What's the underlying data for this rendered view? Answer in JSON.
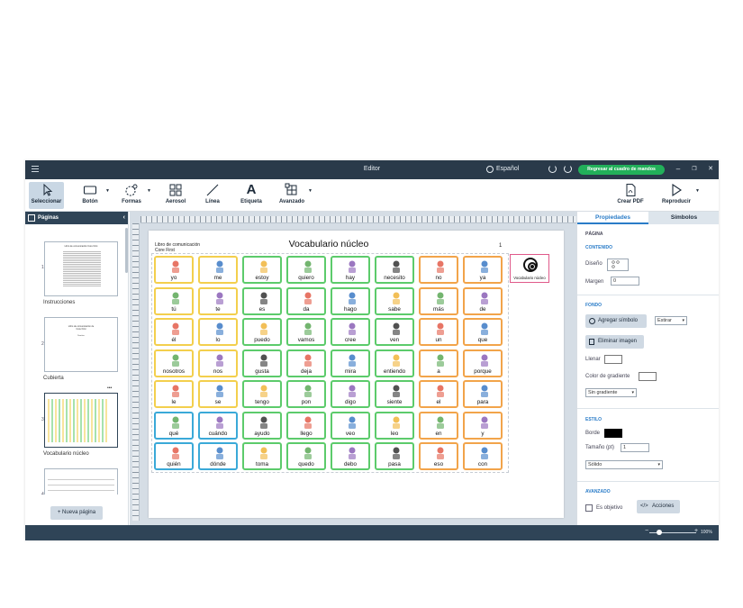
{
  "window": {
    "title": "Editor",
    "language": "Español",
    "dashboard_button": "Regresar al cuadro de mandos",
    "minimize": "–",
    "restore": "❐",
    "close": "✕"
  },
  "toolbar": {
    "select": "Seleccionar",
    "button": "Botón",
    "shapes": "Formas",
    "spray": "Aerosol",
    "line": "Línea",
    "label": "Etiqueta",
    "label_glyph": "A",
    "advanced": "Avanzado",
    "create_pdf": "Crear PDF",
    "play": "Reproducir"
  },
  "pages_panel": {
    "title": "Páginas",
    "collapse": "‹",
    "more": "•••",
    "new_page": "+ Nueva página",
    "thumbnails": [
      {
        "number": "1",
        "label": "Instrucciones",
        "mini_title": "Libro de comunicación Core First"
      },
      {
        "number": "2",
        "label": "Cubierta",
        "mini_title": "Libro de comunicación de",
        "mini_sub": "Core First",
        "mini_name": "Nombre"
      },
      {
        "number": "3",
        "label": "Vocabulario núcleo"
      },
      {
        "number": "4",
        "label": ""
      }
    ]
  },
  "page": {
    "header_line1": "Libro de comunicación",
    "header_line2": "Core First",
    "title": "Vocabulario núcleo",
    "number": "1",
    "vocab_button_label": "Vocabulario núcleo",
    "grid": [
      [
        {
          "w": "yo",
          "c": "yellow"
        },
        {
          "w": "me",
          "c": "yellow"
        },
        {
          "w": "estoy",
          "c": "green"
        },
        {
          "w": "quiero",
          "c": "green"
        },
        {
          "w": "hay",
          "c": "green"
        },
        {
          "w": "necesito",
          "c": "green"
        },
        {
          "w": "no",
          "c": "orange"
        },
        {
          "w": "ya",
          "c": "orange"
        }
      ],
      [
        {
          "w": "tú",
          "c": "yellow"
        },
        {
          "w": "te",
          "c": "yellow"
        },
        {
          "w": "es",
          "c": "green"
        },
        {
          "w": "da",
          "c": "green"
        },
        {
          "w": "hago",
          "c": "green"
        },
        {
          "w": "sabe",
          "c": "green"
        },
        {
          "w": "más",
          "c": "orange"
        },
        {
          "w": "de",
          "c": "orange"
        }
      ],
      [
        {
          "w": "él",
          "c": "yellow"
        },
        {
          "w": "lo",
          "c": "yellow"
        },
        {
          "w": "puedo",
          "c": "green"
        },
        {
          "w": "vamos",
          "c": "green"
        },
        {
          "w": "cree",
          "c": "green"
        },
        {
          "w": "ven",
          "c": "green"
        },
        {
          "w": "un",
          "c": "orange"
        },
        {
          "w": "que",
          "c": "orange"
        }
      ],
      [
        {
          "w": "nosotros",
          "c": "yellow"
        },
        {
          "w": "nos",
          "c": "yellow"
        },
        {
          "w": "gusta",
          "c": "green"
        },
        {
          "w": "deja",
          "c": "green"
        },
        {
          "w": "mira",
          "c": "green"
        },
        {
          "w": "entiendo",
          "c": "green"
        },
        {
          "w": "a",
          "c": "orange"
        },
        {
          "w": "porque",
          "c": "orange"
        }
      ],
      [
        {
          "w": "le",
          "c": "yellow"
        },
        {
          "w": "se",
          "c": "yellow"
        },
        {
          "w": "tengo",
          "c": "green"
        },
        {
          "w": "pon",
          "c": "green"
        },
        {
          "w": "digo",
          "c": "green"
        },
        {
          "w": "siente",
          "c": "green"
        },
        {
          "w": "el",
          "c": "orange"
        },
        {
          "w": "para",
          "c": "orange"
        }
      ],
      [
        {
          "w": "qué",
          "c": "blue"
        },
        {
          "w": "cuándo",
          "c": "blue"
        },
        {
          "w": "ayudo",
          "c": "green"
        },
        {
          "w": "llego",
          "c": "green"
        },
        {
          "w": "veo",
          "c": "green"
        },
        {
          "w": "leo",
          "c": "green"
        },
        {
          "w": "en",
          "c": "orange"
        },
        {
          "w": "y",
          "c": "orange"
        }
      ],
      [
        {
          "w": "quién",
          "c": "blue"
        },
        {
          "w": "dónde",
          "c": "blue"
        },
        {
          "w": "toma",
          "c": "green"
        },
        {
          "w": "quedo",
          "c": "green"
        },
        {
          "w": "debo",
          "c": "green"
        },
        {
          "w": "pasa",
          "c": "green"
        },
        {
          "w": "eso",
          "c": "orange"
        },
        {
          "w": "con",
          "c": "orange"
        }
      ]
    ]
  },
  "properties": {
    "tab_properties": "Propiedades",
    "tab_symbols": "Símbolos",
    "section_page": "PÁGINA",
    "section_content": "CONTENIDO",
    "design_label": "Diseño",
    "margin_label": "Margen",
    "margin_value": "0",
    "section_background": "FONDO",
    "add_symbol": "Agregar símbolo",
    "stretch": "Estirar",
    "remove_image": "Eliminar imagen",
    "fill_label": "Llenar",
    "gradient_color_label": "Color de gradiente",
    "gradient_select": "Sin gradiente",
    "section_style": "ESTILO",
    "border_label": "Borde",
    "size_label": "Tamaño (pt)",
    "size_value": "1",
    "line_style": "Sólido",
    "section_advanced": "AVANZADO",
    "is_target": "Es objetivo",
    "actions": "Acciones"
  },
  "status": {
    "zoom_minus": "−",
    "zoom_plus": "+",
    "zoom": "100%"
  },
  "colors": {
    "yellow": "#f3cf4d",
    "green": "#5ccb6b",
    "orange": "#f2a44a",
    "blue": "#3aa9d8",
    "dashboard": "#22b05a",
    "titlebar": "#2a3a4a"
  }
}
